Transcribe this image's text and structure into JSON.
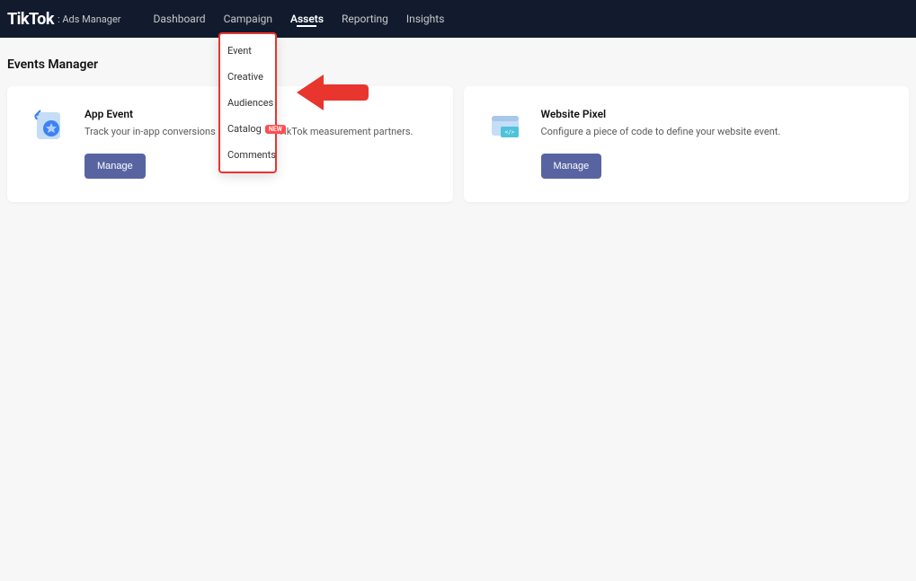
{
  "header": {
    "logo": "TikTok",
    "logoSub": ": Ads Manager",
    "nav": {
      "dashboard": "Dashboard",
      "campaign": "Campaign",
      "assets": "Assets",
      "reporting": "Reporting",
      "insights": "Insights"
    }
  },
  "dropdown": {
    "event": "Event",
    "creative": "Creative",
    "audiences": "Audiences",
    "catalog": "Catalog",
    "catalogBadge": "NEW",
    "comments": "Comments"
  },
  "page": {
    "title": "Events Manager"
  },
  "cards": {
    "appEvent": {
      "title": "App Event",
      "desc": "Track your in-app conversions accurately by TikTok measurement partners.",
      "button": "Manage"
    },
    "websitePixel": {
      "title": "Website Pixel",
      "desc": "Configure a piece of code to define your website event.",
      "button": "Manage"
    }
  }
}
